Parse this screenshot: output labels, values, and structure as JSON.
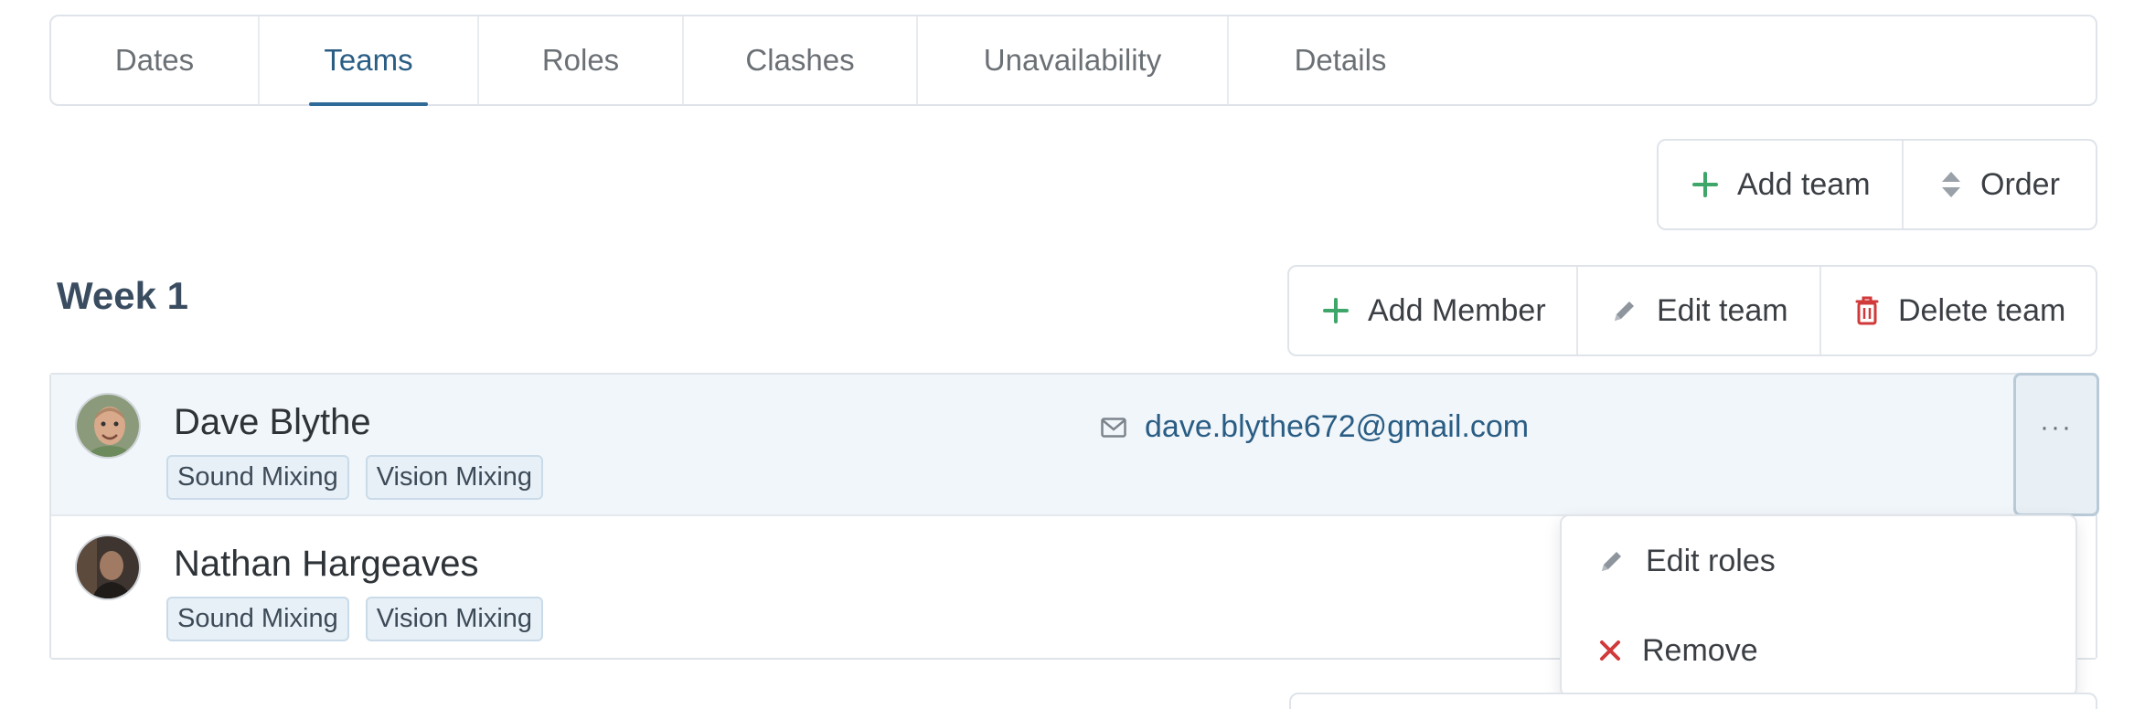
{
  "tabs": [
    {
      "label": "Dates"
    },
    {
      "label": "Teams"
    },
    {
      "label": "Roles"
    },
    {
      "label": "Clashes"
    },
    {
      "label": "Unavailability"
    },
    {
      "label": "Details"
    }
  ],
  "active_tab": "Teams",
  "toolbar": {
    "add_team": "Add team",
    "order": "Order"
  },
  "team": {
    "name": "Week 1",
    "actions": {
      "add_member": "Add Member",
      "edit_team": "Edit team",
      "delete_team": "Delete team"
    },
    "members": [
      {
        "name": "Dave Blythe",
        "email": "dave.blythe672@gmail.com",
        "roles": [
          "Sound Mixing",
          "Vision Mixing"
        ]
      },
      {
        "name": "Nathan Hargeaves",
        "roles": [
          "Sound Mixing",
          "Vision Mixing"
        ]
      }
    ]
  },
  "more_button": "···",
  "dropdown": {
    "edit_roles": "Edit roles",
    "remove": "Remove"
  },
  "icons": {
    "add": "plus-icon",
    "order": "sort-icon",
    "edit": "pencil-icon",
    "delete": "trash-icon",
    "email": "envelope-icon",
    "remove": "close-icon"
  },
  "colors": {
    "accent": "#2f6b98",
    "add_green": "#3fa66a",
    "delete_red": "#d03a3a",
    "row_highlight": "#f1f6fa"
  }
}
